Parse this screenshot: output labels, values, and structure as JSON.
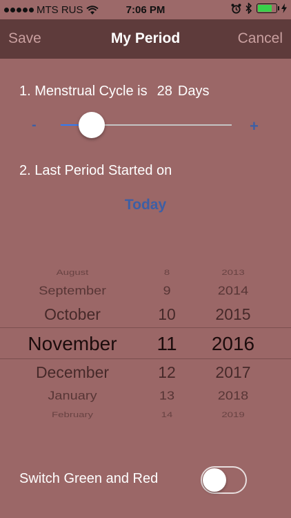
{
  "status_bar": {
    "carrier": "MTS RUS",
    "time": "7:06 PM",
    "battery_level": 0.8,
    "battery_color": "#39d14a"
  },
  "nav": {
    "save_label": "Save",
    "title": "My Period",
    "cancel_label": "Cancel"
  },
  "cycle": {
    "label": "1. Menstrual Cycle is",
    "days": "28",
    "unit": "Days",
    "minus_label": "-",
    "plus_label": "+",
    "slider_level": 0.18
  },
  "last_period": {
    "label": "2. Last Period Started on",
    "today_label": "Today"
  },
  "picker": {
    "months": [
      "August",
      "September",
      "October",
      "November",
      "December",
      "January",
      "February"
    ],
    "days": [
      "8",
      "9",
      "10",
      "11",
      "12",
      "13",
      "14"
    ],
    "years": [
      "2013",
      "2014",
      "2015",
      "2016",
      "2017",
      "2018",
      "2019"
    ],
    "selected_index": 3
  },
  "switch": {
    "label": "Switch Green and Red",
    "on": false
  },
  "colors": {
    "background": "#9b6767",
    "nav": "#5e3b3b",
    "accent_blue": "#3d5fa5",
    "slider_fill": "#2f7bf5"
  },
  "icons": [
    "signal-dots-icon",
    "wifi-icon",
    "alarm-icon",
    "bluetooth-icon",
    "battery-icon",
    "charging-bolt-icon"
  ]
}
